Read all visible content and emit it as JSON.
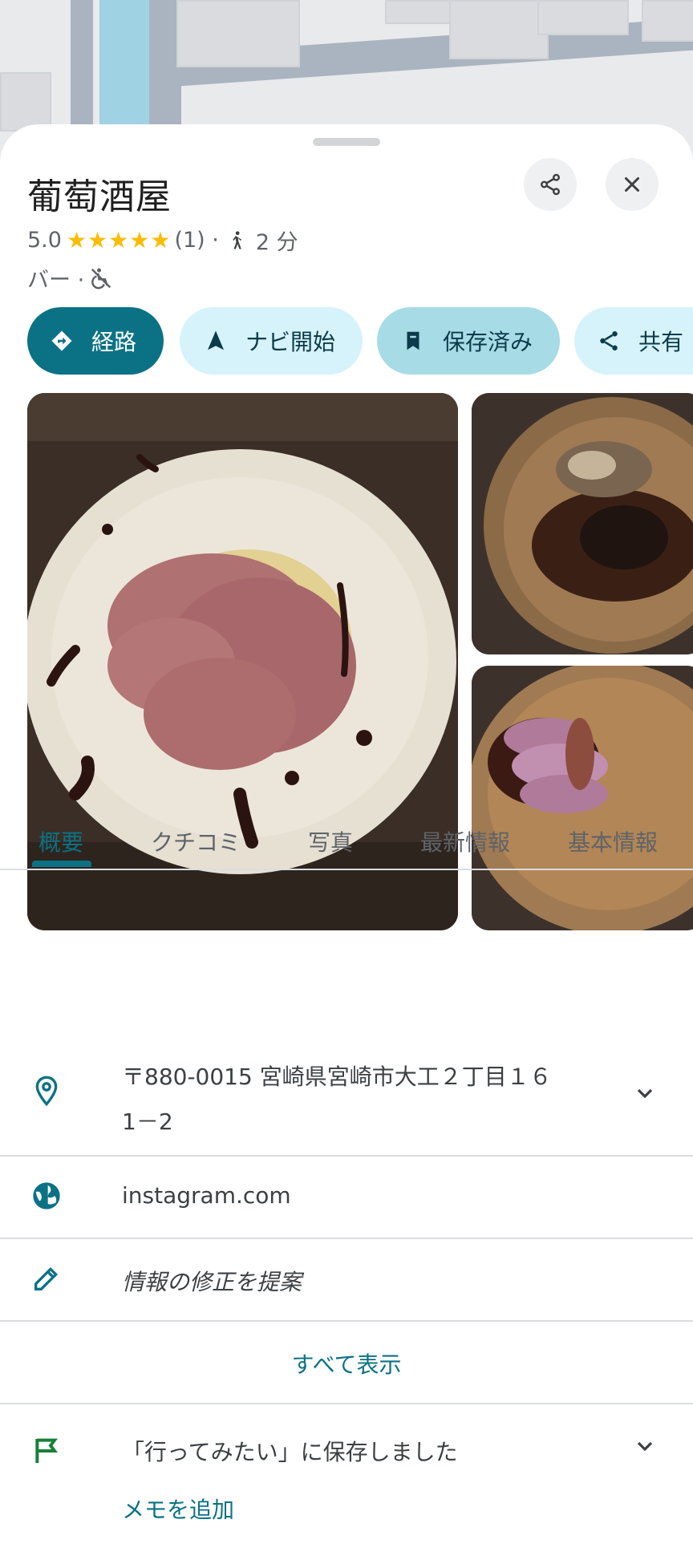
{
  "place": {
    "name": "葡萄酒屋",
    "rating": "5.0",
    "stars": "★★★★★",
    "review_count": "(1) ·",
    "walk_time": "2 分",
    "category": "バー ·"
  },
  "actions": [
    {
      "label": "経路",
      "icon": "directions-icon"
    },
    {
      "label": "ナビ開始",
      "icon": "navigation-arrow-icon"
    },
    {
      "label": "保存済み",
      "icon": "bookmark-icon"
    },
    {
      "label": "共有",
      "icon": "share-icon"
    }
  ],
  "tabs": [
    "概要",
    "クチコミ",
    "写真",
    "最新情報",
    "基本情報"
  ],
  "details": {
    "address_line1": "〒880-0015 宮崎県宮崎市大工２丁目１６",
    "address_line2": "1－2",
    "website": "instagram.com",
    "suggest_edit": "情報の修正を提案",
    "show_all": "すべて表示"
  },
  "saved": {
    "text": "「行ってみたい」に保存しました",
    "add_note": "メモを追加"
  },
  "colors": {
    "accent": "#0b7285",
    "tonal_chip": "#d6f3fb",
    "saved_chip": "#a7dbe6",
    "star": "#fbbc04",
    "flag": "#188038"
  }
}
